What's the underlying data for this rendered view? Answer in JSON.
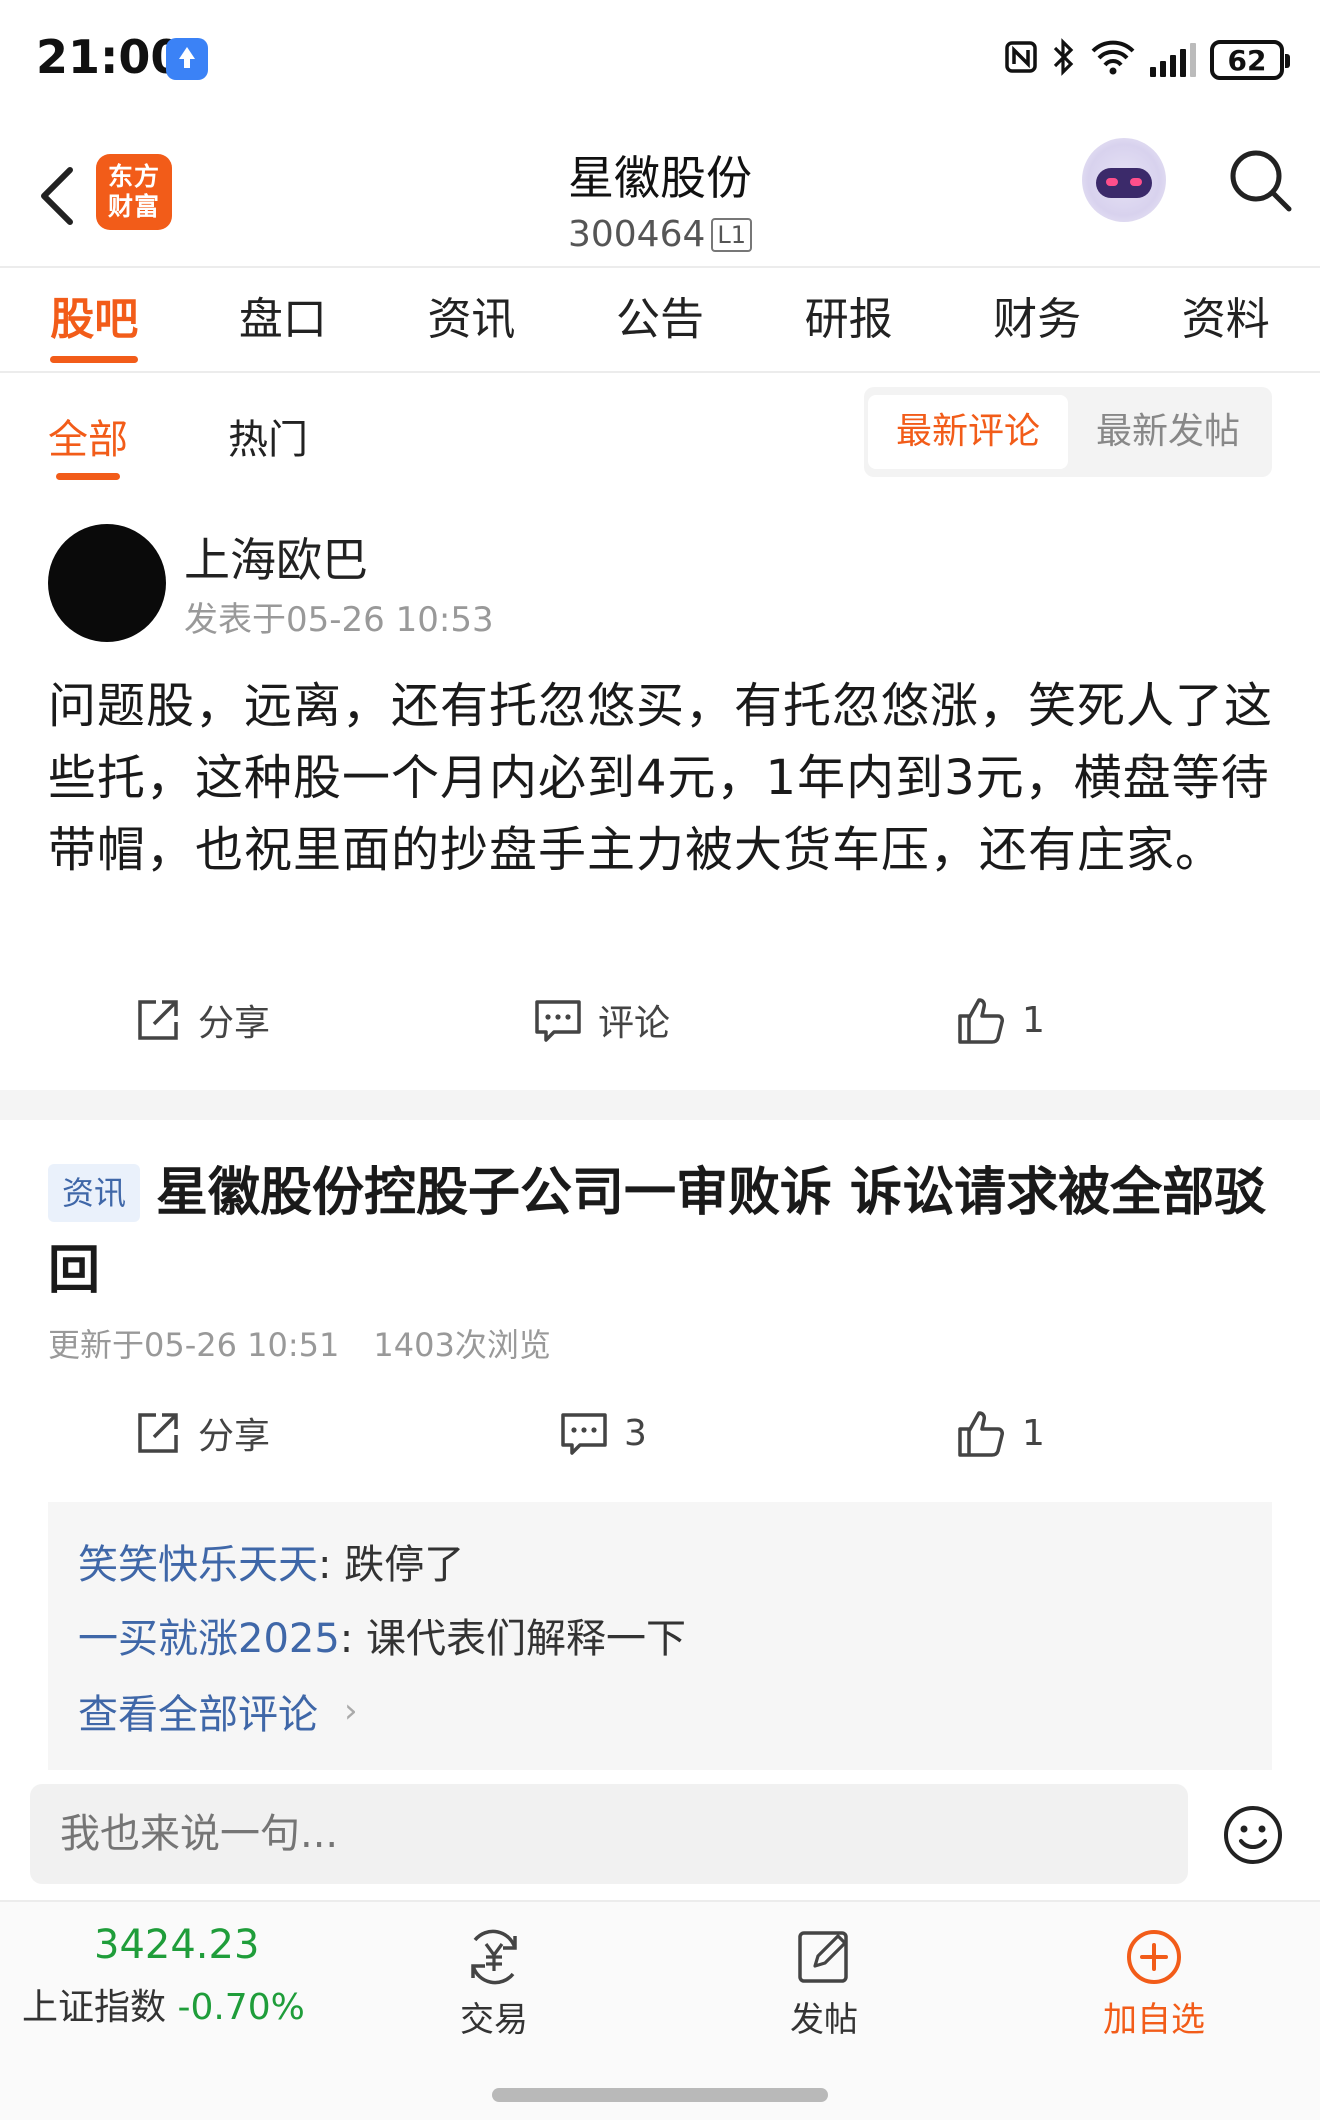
{
  "status_bar": {
    "time": "21:00",
    "battery": "62"
  },
  "header": {
    "logo_text": "东方财富",
    "stock_name": "星徽股份",
    "stock_code": "300464",
    "level_badge": "L1"
  },
  "main_tabs": [
    {
      "label": "股吧",
      "active": true
    },
    {
      "label": "盘口"
    },
    {
      "label": "资讯"
    },
    {
      "label": "公告"
    },
    {
      "label": "研报"
    },
    {
      "label": "财务"
    },
    {
      "label": "资料"
    }
  ],
  "filter_tabs": [
    {
      "label": "全部",
      "active": true
    },
    {
      "label": "热门"
    }
  ],
  "sort_options": [
    {
      "label": "最新评论",
      "active": true
    },
    {
      "label": "最新发帖"
    }
  ],
  "post1": {
    "author": "上海欧巴",
    "time": "发表于05-26 10:53",
    "body": "问题股，远离，还有托忽悠买，有托忽悠涨，笑死人了这些托，这种股一个月内必到4元，1年内到3元，横盘等待带帽，也祝里面的抄盘手主力被大货车压，还有庄家。",
    "share_label": "分享",
    "comment_label": "评论",
    "likes": "1"
  },
  "post2": {
    "tag": "资讯",
    "title": "星徽股份控股子公司一审败诉 诉讼请求被全部驳回",
    "updated": "更新于05-26 10:51",
    "views": "1403次浏览",
    "share_label": "分享",
    "comments_count": "3",
    "likes": "1",
    "comments": [
      {
        "user": "笑笑快乐天天",
        "sep": ":",
        "text": "跌停了"
      },
      {
        "user": "一买就涨2025",
        "sep": ":",
        "text": "课代表们解释一下"
      }
    ],
    "view_all": "查看全部评论"
  },
  "input_bar": {
    "placeholder": "我也来说一句..."
  },
  "bottom_bar": {
    "index_value": "3424.23",
    "index_name": "上证指数",
    "index_change": "-0.70%",
    "trade_label": "交易",
    "post_label": "发帖",
    "add_label": "加自选"
  },
  "colors": {
    "accent": "#f25c19",
    "link": "#3f67a8",
    "down_green": "#1f9d3a"
  }
}
